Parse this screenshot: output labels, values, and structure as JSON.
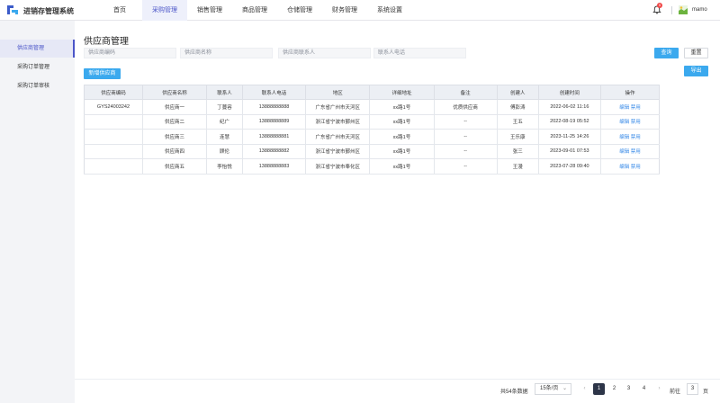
{
  "app": {
    "title": "进销存管理系统",
    "logo_icon": "logo-icon"
  },
  "nav": [
    {
      "label": "首页",
      "active": false
    },
    {
      "label": "采购管理",
      "active": true
    },
    {
      "label": "销售管理",
      "active": false
    },
    {
      "label": "商品管理",
      "active": false
    },
    {
      "label": "仓储管理",
      "active": false
    },
    {
      "label": "财务管理",
      "active": false
    },
    {
      "label": "系统设置",
      "active": false
    }
  ],
  "header": {
    "badge_count": "5",
    "username": "mamo",
    "bell_icon": "bell-icon",
    "avatar_icon": "avatar"
  },
  "sidebar": {
    "items": [
      {
        "label": "供应商管理",
        "active": true
      },
      {
        "label": "采购订单管理",
        "active": false
      },
      {
        "label": "采购订单审核",
        "active": false
      }
    ]
  },
  "page": {
    "title": "供应商管理"
  },
  "filters": {
    "code": {
      "placeholder": "供应商编码"
    },
    "name": {
      "placeholder": "供应商名称"
    },
    "contact": {
      "placeholder": "供应商联系人"
    },
    "phone": {
      "placeholder": "联系人电话"
    }
  },
  "buttons": {
    "search": "查询",
    "reset": "重置",
    "add": "新增供应商",
    "export": "导出"
  },
  "table": {
    "headers": [
      "供应商编码",
      "供应商名称",
      "联系人",
      "联系人电话",
      "地区",
      "详细地址",
      "备注",
      "创建人",
      "创建时间",
      "操作"
    ],
    "rows": [
      [
        "GYS24003242",
        "供应商一",
        "丁蔓容",
        "13888888888",
        "广东省广州市天河区",
        "xx路1号",
        "优质供应商",
        "傅彭涛",
        "2022-06-02 11:16",
        "编辑",
        "禁用"
      ],
      [
        "",
        "供应商二",
        "纪广",
        "13888888889",
        "浙江省宁波市鄞州区",
        "xx路1号",
        "--",
        "王五",
        "2022-08-19 05:52",
        "编辑",
        "禁用"
      ],
      [
        "",
        "供应商三",
        "连慧",
        "13888888881",
        "广东省广州市天河区",
        "xx路1号",
        "--",
        "王乐康",
        "2023-11-25 14:26",
        "编辑",
        "禁用"
      ],
      [
        "",
        "供应商四",
        "顾伦",
        "13888888882",
        "浙江省宁波市鄞州区",
        "xx路1号",
        "--",
        "张三",
        "2023-09-01 07:53",
        "编辑",
        "禁用"
      ],
      [
        "",
        "供应商五",
        "李怡悦",
        "13888888883",
        "浙江省宁波市奉化区",
        "xx路1号",
        "--",
        "王漫",
        "2023-07-28 09:40",
        "编辑",
        "禁用"
      ]
    ]
  },
  "pagination": {
    "total": "共54条数据",
    "page_size": "15条/页",
    "pages": [
      "1",
      "2",
      "3",
      "4"
    ],
    "current": "1",
    "prev_icon": "‹",
    "next_icon": "›",
    "goto_label": "前往",
    "goto_value": "3",
    "page_unit": "页"
  },
  "colors": {
    "accent": "#4b55c8",
    "primary_button": "#3ba9ee",
    "badge": "#f04848",
    "active_page": "#2d3548"
  }
}
